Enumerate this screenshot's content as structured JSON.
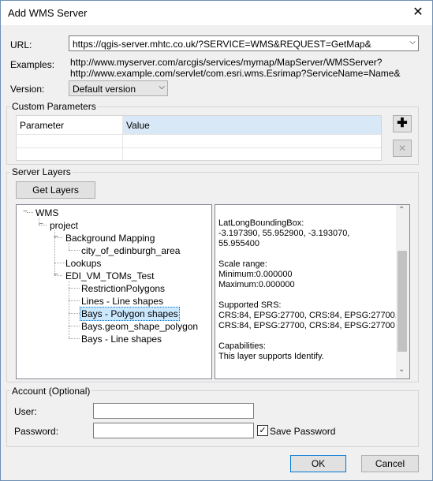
{
  "window": {
    "title": "Add WMS Server",
    "close_glyph": "✕"
  },
  "url": {
    "label": "URL:",
    "value": "https://qgis-server.mhtc.co.uk/?SERVICE=WMS&REQUEST=GetMap&"
  },
  "examples": {
    "label": "Examples:",
    "lines": [
      "http://www.myserver.com/arcgis/services/mymap/MapServer/WMSServer?",
      "http://www.example.com/servlet/com.esri.wms.Esrimap?ServiceName=Name&"
    ]
  },
  "version": {
    "label": "Version:",
    "value": "Default version"
  },
  "custom_params": {
    "title": "Custom Parameters",
    "col_parameter": "Parameter",
    "col_value": "Value",
    "add_glyph": "✚",
    "remove_glyph": "✕"
  },
  "server_layers": {
    "title": "Server Layers",
    "get_layers_label": "Get Layers",
    "tree": [
      {
        "label": "WMS",
        "selected": false
      },
      {
        "label": "project",
        "selected": false
      },
      {
        "label": "Background Mapping",
        "selected": false
      },
      {
        "label": "city_of_edinburgh_area",
        "selected": false
      },
      {
        "label": "Lookups",
        "selected": false
      },
      {
        "label": "EDI_VM_TOMs_Test",
        "selected": false
      },
      {
        "label": "RestrictionPolygons",
        "selected": false
      },
      {
        "label": "Lines - Line shapes",
        "selected": false
      },
      {
        "label": "Bays - Polygon shapes",
        "selected": true
      },
      {
        "label": "Bays.geom_shape_polygon",
        "selected": false
      },
      {
        "label": "Bays - Line shapes",
        "selected": false
      }
    ],
    "info_lines": [
      "LatLongBoundingBox:",
      "-3.197390, 55.952900, -3.193070,",
      "55.955400",
      "",
      "Scale range:",
      "Minimum:0.000000",
      "Maximum:0.000000",
      "",
      "Supported SRS:",
      " CRS:84, EPSG:27700, CRS:84, EPSG:27700,",
      "CRS:84, EPSG:27700, CRS:84, EPSG:27700",
      "",
      "Capabilities:",
      "This layer supports Identify."
    ]
  },
  "account": {
    "title": "Account (Optional)",
    "user_label": "User:",
    "user_value": "",
    "password_label": "Password:",
    "password_value": "",
    "save_password_label": "Save Password",
    "save_password_checked": true
  },
  "buttons": {
    "ok": "OK",
    "cancel": "Cancel"
  },
  "colors": {
    "selection": "#cce8ff",
    "selection_border": "#0078d7",
    "header_value_bg": "#d9e8f7"
  }
}
